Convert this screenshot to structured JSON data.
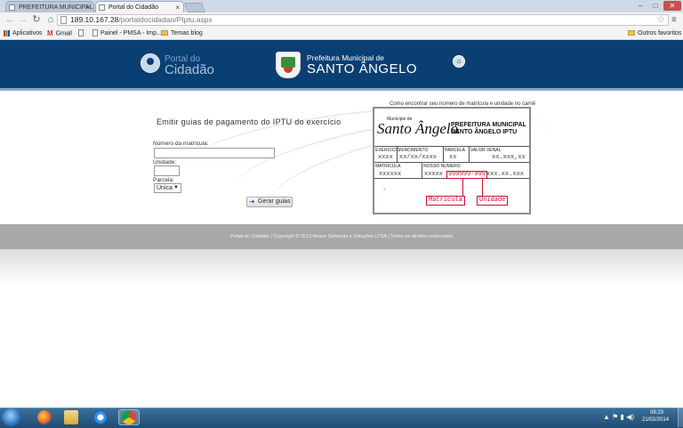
{
  "browser": {
    "tabs": [
      {
        "label": "PREFEITURA MUNICIPAL",
        "close": "×"
      },
      {
        "label": "Portal do Cidadão",
        "close": "×"
      }
    ],
    "url_host": "189.10.167.28",
    "url_path": "/portaldocidadao/PIptu.aspx",
    "nav": {
      "back": "←",
      "forward": "→",
      "reload": "↻",
      "home": "⌂",
      "star": "☆",
      "menu": "≡"
    },
    "window_controls": {
      "minimize": "–",
      "maximize": "□",
      "close": "✕"
    },
    "bookmarks": [
      "Aplicativos",
      "Gmail",
      "Painel - PMSA - Imp...",
      "Temas blog"
    ],
    "other_bookmarks": "Outros favoritos"
  },
  "header": {
    "portal_line1": "Portal do",
    "portal_line2": "Cidadão",
    "prefeitura_line1": "Prefeitura Municipal de",
    "prefeitura_line2": "SANTO ÂNGELO",
    "home_icon": "⌂"
  },
  "form": {
    "title": "Emitir guias de pagamento do IPTU do exercício",
    "matricula_label": "Número da matrícula:",
    "matricula_value": "",
    "unidade_label": "Unidade:",
    "unidade_value": "",
    "parcela_label": "Parcela:",
    "parcela_selected": "Única",
    "submit_label": "Gerar guias"
  },
  "carne": {
    "help_text": "Como encontrar seu número de matrícula e unidade no carnê",
    "municipio_de": "Município de",
    "city": "Santo Ângelo",
    "pref_line1": "PREFEITURA MUNICIPAL DE",
    "pref_line2": "SANTO ÂNGELO IPTU",
    "labels": {
      "exercicio": "EXERCICIO",
      "vencimento": "VENCIMENTO",
      "parcela": "PARCELA",
      "valor_venal": "VALOR VENAL",
      "matricula": "MATRICULA",
      "nosso_numero": "NOSSO NUMERO"
    },
    "values": {
      "exercicio": "xxxx",
      "vencimento": "xx/xx/xxxx",
      "parcela": "xx",
      "valor_venal": "xx.xxx,xx",
      "matricula": "xxxxxx",
      "nn_prefix": "xxxxx",
      "nn_highlight": "999999-999",
      "nn_suffix": "xxx.xx.xxx",
      "dot": "."
    },
    "callouts": {
      "matricula": "Matrícula",
      "unidade": "Unidade"
    }
  },
  "footer": {
    "text": "Portal do Cidadão  |  Copyright © 2013 Abase Sistemas e Soluções LTDA  |  Todos os direitos reservados"
  },
  "taskbar": {
    "apps": [
      "firefox-icon",
      "explorer-icon",
      "ie-icon",
      "chrome-icon"
    ],
    "tray": "▲ ⚑ ▮ ◀)",
    "time": "08:23",
    "date": "21/02/2014"
  }
}
